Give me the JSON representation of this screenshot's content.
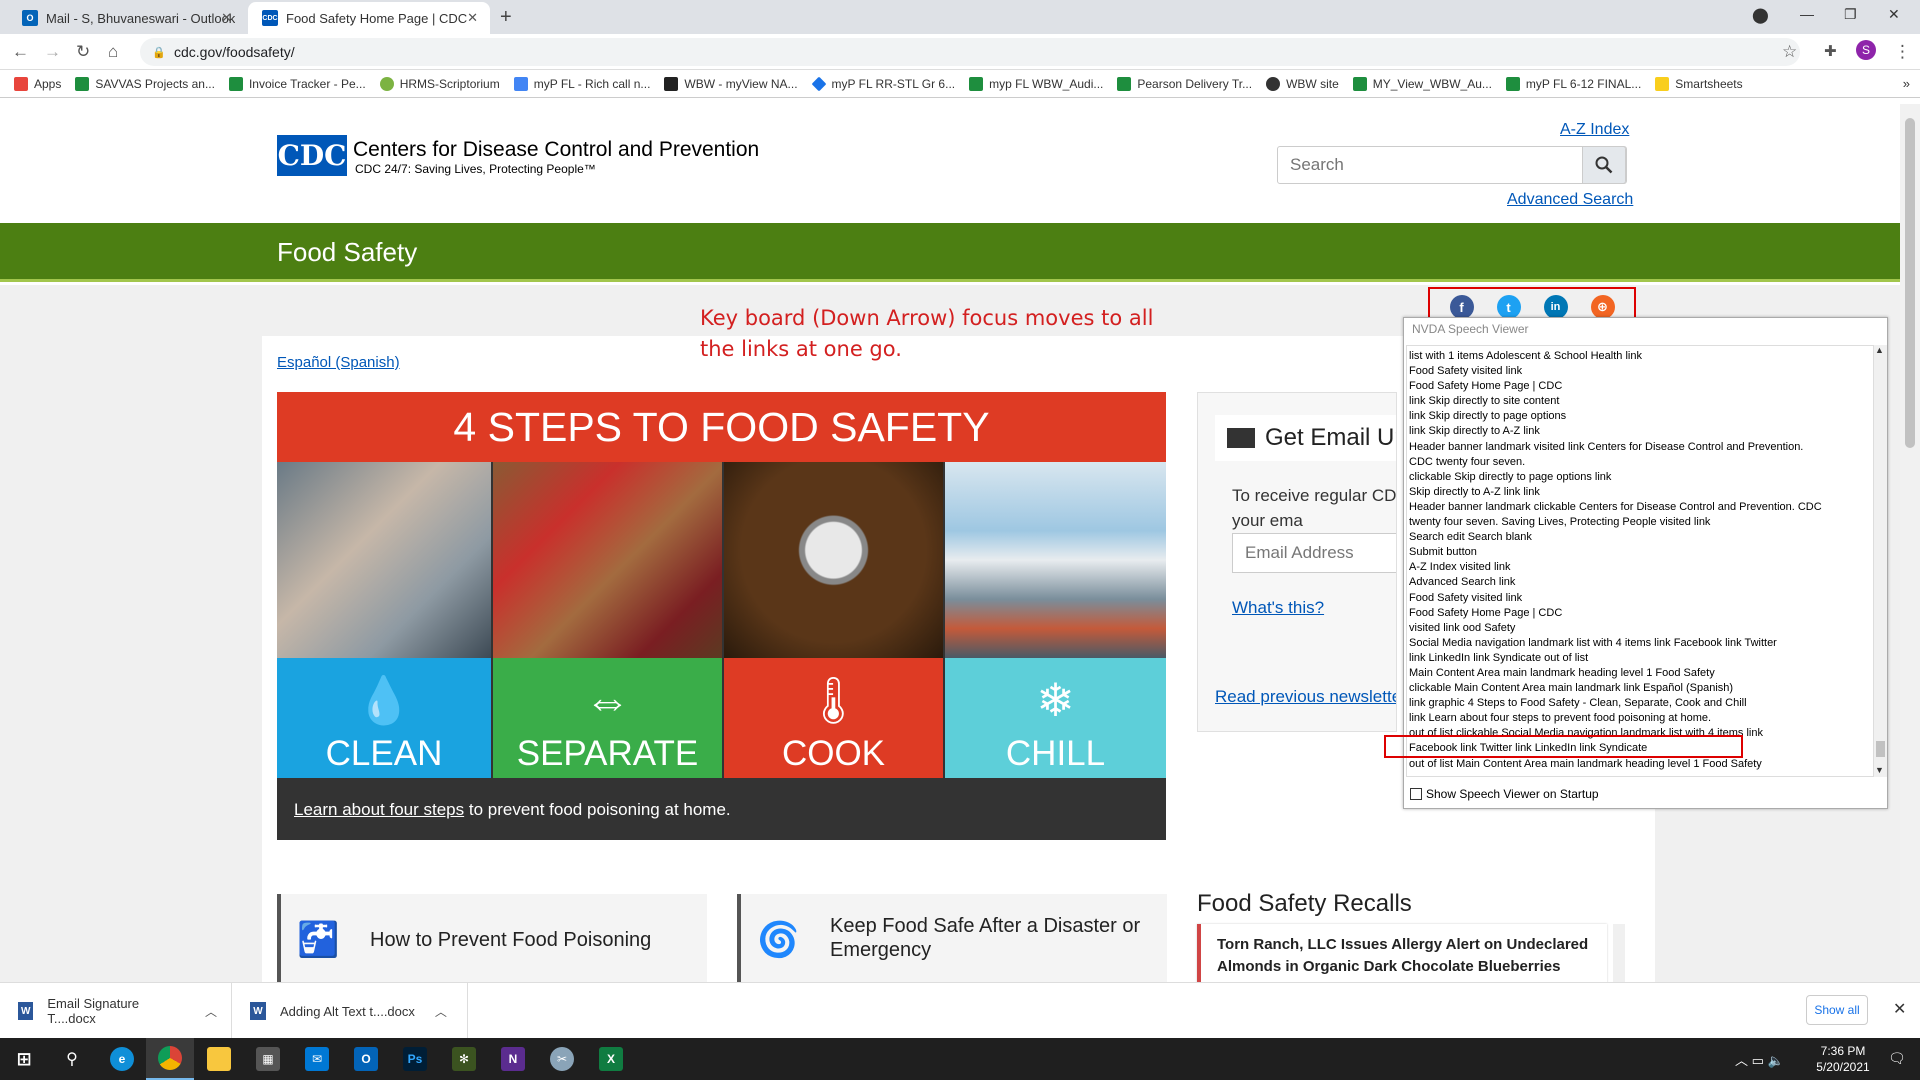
{
  "browser": {
    "tabs": [
      {
        "label": "Mail - S, Bhuvaneswari - Outlook",
        "icon": "outlook-icon"
      },
      {
        "label": "Food Safety Home Page | CDC",
        "icon": "cdc-icon"
      }
    ],
    "url": "cdc.gov/foodsafety/",
    "bookmarks": [
      {
        "label": "Apps",
        "color": "#e8453c"
      },
      {
        "label": "SAVVAS Projects an...",
        "color": "#1e8e3e"
      },
      {
        "label": "Invoice Tracker - Pe...",
        "color": "#1e8e3e"
      },
      {
        "label": "HRMS-Scriptorium",
        "color": "#7cb342"
      },
      {
        "label": "myP FL - Rich call n...",
        "color": "#4285f4"
      },
      {
        "label": "WBW - myView NA...",
        "color": "#222222"
      },
      {
        "label": "myP FL RR-STL Gr 6...",
        "color": "#1a73e8"
      },
      {
        "label": "myp FL WBW_Audi...",
        "color": "#1e8e3e"
      },
      {
        "label": "Pearson Delivery Tr...",
        "color": "#1e8e3e"
      },
      {
        "label": "WBW site",
        "color": "#333333"
      },
      {
        "label": "MY_View_WBW_Au...",
        "color": "#1e8e3e"
      },
      {
        "label": "myP FL 6-12 FINAL...",
        "color": "#1e8e3e"
      },
      {
        "label": "Smartsheets",
        "color": "#f9ce1d"
      }
    ]
  },
  "header": {
    "logo_text": "CDC",
    "title": "Centers for Disease Control and Prevention",
    "tagline": "CDC 24/7: Saving Lives, Protecting People™",
    "az_index": "A-Z Index",
    "search_placeholder": "Search",
    "advanced_search": "Advanced Search"
  },
  "section_title": "Food Safety",
  "annotation": "Key board (Down Arrow) focus moves to all the links at one go.",
  "espanol_link": "Español (Spanish)",
  "hero": {
    "title": "4 STEPS TO FOOD SAFETY",
    "steps": [
      {
        "label": "CLEAN",
        "icon": "water-drop-icon",
        "color": "#1aa3e0"
      },
      {
        "label": "SEPARATE",
        "icon": "arrows-icon",
        "color": "#3aad49"
      },
      {
        "label": "COOK",
        "icon": "thermometer-icon",
        "color": "#de3b24"
      },
      {
        "label": "CHILL",
        "icon": "snowflake-icon",
        "color": "#5dcfd9"
      }
    ],
    "caption_link": "Learn about four steps",
    "caption_rest": " to prevent food poisoning at home."
  },
  "email": {
    "heading": "Get Email Up",
    "text": "To receive regular CDC safety, enter your ema",
    "input_placeholder": "Email Address",
    "whats_this": "What's this?",
    "previous": "Read previous newslette"
  },
  "nvda": {
    "title": "NVDA Speech Viewer",
    "lines": [
      "list  with 1 items  Adolescent & School Health  link",
      "Food Safety  visited  link",
      "Food Safety Home Page | CDC",
      "link   Skip directly to site content",
      "link   Skip directly to page options",
      "link   Skip directly to A-Z link",
      "Header  banner landmark   visited  link    Centers for Disease Control and Prevention.",
      "CDC twenty four seven.",
      "clickable  Skip directly to page options  link",
      "Skip directly to A-Z link  link",
      "Header  banner landmark  clickable     Centers for Disease Control and Prevention. CDC",
      "twenty four seven. Saving Lives, Protecting People  visited  link",
      "Search  edit  Search  blank",
      "Submit  button",
      "A-Z Index  visited  link",
      "Advanced Search  link",
      "Food Safety  visited  link",
      "Food Safety Home Page | CDC",
      "visited  link    ood Safety",
      "Social Media  navigation landmark    list  with 4 items  link    Facebook  link    Twitter",
      "link    LinkedIn  link    Syndicate  out of list",
      "Main Content Area  main landmark     heading     level 1  Food Safety",
      "clickable  Main Content Area  main landmark     link    Español (Spanish)",
      "link    graphic     4 Steps to Food Safety - Clean, Separate, Cook and Chill",
      "link    Learn about four steps  to prevent food poisoning at home.",
      "out of list  clickable  Social Media  navigation landmark    list  with 4 items  link",
      "Facebook  link    Twitter  link    LinkedIn  link    Syndicate",
      "out of list  Main Content Area  main landmark     heading     level 1  Food Safety"
    ],
    "checkbox_label": "Show Speech Viewer on Startup"
  },
  "cards": [
    {
      "label": "How to Prevent Food Poisoning",
      "icon": "handwash-icon"
    },
    {
      "label": "Keep Food Safe After a Disaster or Emergency",
      "icon": "hurricane-icon"
    }
  ],
  "recalls": {
    "title": "Food Safety Recalls",
    "item": "Torn Ranch, LLC Issues Allergy Alert on Undeclared Almonds in Organic Dark Chocolate Blueberries"
  },
  "downloads": [
    {
      "label": "Email Signature T....docx"
    },
    {
      "label": "Adding Alt Text t....docx"
    }
  ],
  "show_all": "Show all",
  "clock": {
    "time": "7:36 PM",
    "date": "5/20/2021"
  }
}
